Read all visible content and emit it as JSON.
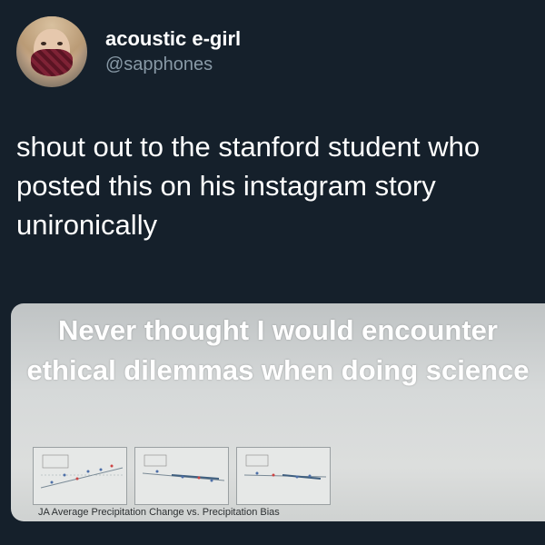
{
  "user": {
    "display_name": "acoustic e-girl",
    "handle": "@sapphones",
    "avatar_icon": "profile-photo-woman-with-mask"
  },
  "tweet": {
    "text": "shout out to the stanford student who posted this on his instagram story unironically"
  },
  "media": {
    "caption": "Never thought I would encounter ethical dilemmas when doing science",
    "plot_caption": "JA Average Precipitation Change vs. Precipitation Bias"
  },
  "colors": {
    "background": "#15202b",
    "text_primary": "#ffffff",
    "text_secondary": "#8899a6"
  }
}
